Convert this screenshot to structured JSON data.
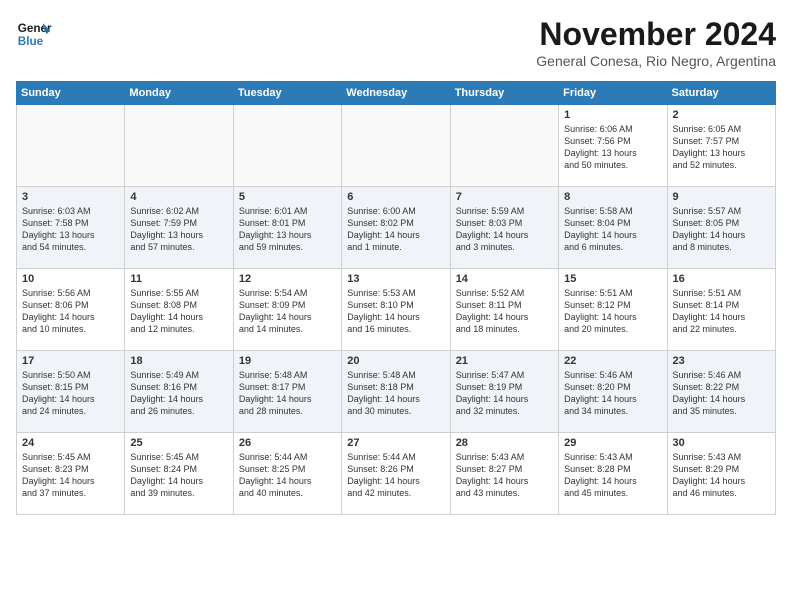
{
  "logo": {
    "line1": "General",
    "line2": "Blue"
  },
  "title": "November 2024",
  "subtitle": "General Conesa, Rio Negro, Argentina",
  "weekdays": [
    "Sunday",
    "Monday",
    "Tuesday",
    "Wednesday",
    "Thursday",
    "Friday",
    "Saturday"
  ],
  "weeks": [
    [
      {
        "day": "",
        "info": ""
      },
      {
        "day": "",
        "info": ""
      },
      {
        "day": "",
        "info": ""
      },
      {
        "day": "",
        "info": ""
      },
      {
        "day": "",
        "info": ""
      },
      {
        "day": "1",
        "info": "Sunrise: 6:06 AM\nSunset: 7:56 PM\nDaylight: 13 hours\nand 50 minutes."
      },
      {
        "day": "2",
        "info": "Sunrise: 6:05 AM\nSunset: 7:57 PM\nDaylight: 13 hours\nand 52 minutes."
      }
    ],
    [
      {
        "day": "3",
        "info": "Sunrise: 6:03 AM\nSunset: 7:58 PM\nDaylight: 13 hours\nand 54 minutes."
      },
      {
        "day": "4",
        "info": "Sunrise: 6:02 AM\nSunset: 7:59 PM\nDaylight: 13 hours\nand 57 minutes."
      },
      {
        "day": "5",
        "info": "Sunrise: 6:01 AM\nSunset: 8:01 PM\nDaylight: 13 hours\nand 59 minutes."
      },
      {
        "day": "6",
        "info": "Sunrise: 6:00 AM\nSunset: 8:02 PM\nDaylight: 14 hours\nand 1 minute."
      },
      {
        "day": "7",
        "info": "Sunrise: 5:59 AM\nSunset: 8:03 PM\nDaylight: 14 hours\nand 3 minutes."
      },
      {
        "day": "8",
        "info": "Sunrise: 5:58 AM\nSunset: 8:04 PM\nDaylight: 14 hours\nand 6 minutes."
      },
      {
        "day": "9",
        "info": "Sunrise: 5:57 AM\nSunset: 8:05 PM\nDaylight: 14 hours\nand 8 minutes."
      }
    ],
    [
      {
        "day": "10",
        "info": "Sunrise: 5:56 AM\nSunset: 8:06 PM\nDaylight: 14 hours\nand 10 minutes."
      },
      {
        "day": "11",
        "info": "Sunrise: 5:55 AM\nSunset: 8:08 PM\nDaylight: 14 hours\nand 12 minutes."
      },
      {
        "day": "12",
        "info": "Sunrise: 5:54 AM\nSunset: 8:09 PM\nDaylight: 14 hours\nand 14 minutes."
      },
      {
        "day": "13",
        "info": "Sunrise: 5:53 AM\nSunset: 8:10 PM\nDaylight: 14 hours\nand 16 minutes."
      },
      {
        "day": "14",
        "info": "Sunrise: 5:52 AM\nSunset: 8:11 PM\nDaylight: 14 hours\nand 18 minutes."
      },
      {
        "day": "15",
        "info": "Sunrise: 5:51 AM\nSunset: 8:12 PM\nDaylight: 14 hours\nand 20 minutes."
      },
      {
        "day": "16",
        "info": "Sunrise: 5:51 AM\nSunset: 8:14 PM\nDaylight: 14 hours\nand 22 minutes."
      }
    ],
    [
      {
        "day": "17",
        "info": "Sunrise: 5:50 AM\nSunset: 8:15 PM\nDaylight: 14 hours\nand 24 minutes."
      },
      {
        "day": "18",
        "info": "Sunrise: 5:49 AM\nSunset: 8:16 PM\nDaylight: 14 hours\nand 26 minutes."
      },
      {
        "day": "19",
        "info": "Sunrise: 5:48 AM\nSunset: 8:17 PM\nDaylight: 14 hours\nand 28 minutes."
      },
      {
        "day": "20",
        "info": "Sunrise: 5:48 AM\nSunset: 8:18 PM\nDaylight: 14 hours\nand 30 minutes."
      },
      {
        "day": "21",
        "info": "Sunrise: 5:47 AM\nSunset: 8:19 PM\nDaylight: 14 hours\nand 32 minutes."
      },
      {
        "day": "22",
        "info": "Sunrise: 5:46 AM\nSunset: 8:20 PM\nDaylight: 14 hours\nand 34 minutes."
      },
      {
        "day": "23",
        "info": "Sunrise: 5:46 AM\nSunset: 8:22 PM\nDaylight: 14 hours\nand 35 minutes."
      }
    ],
    [
      {
        "day": "24",
        "info": "Sunrise: 5:45 AM\nSunset: 8:23 PM\nDaylight: 14 hours\nand 37 minutes."
      },
      {
        "day": "25",
        "info": "Sunrise: 5:45 AM\nSunset: 8:24 PM\nDaylight: 14 hours\nand 39 minutes."
      },
      {
        "day": "26",
        "info": "Sunrise: 5:44 AM\nSunset: 8:25 PM\nDaylight: 14 hours\nand 40 minutes."
      },
      {
        "day": "27",
        "info": "Sunrise: 5:44 AM\nSunset: 8:26 PM\nDaylight: 14 hours\nand 42 minutes."
      },
      {
        "day": "28",
        "info": "Sunrise: 5:43 AM\nSunset: 8:27 PM\nDaylight: 14 hours\nand 43 minutes."
      },
      {
        "day": "29",
        "info": "Sunrise: 5:43 AM\nSunset: 8:28 PM\nDaylight: 14 hours\nand 45 minutes."
      },
      {
        "day": "30",
        "info": "Sunrise: 5:43 AM\nSunset: 8:29 PM\nDaylight: 14 hours\nand 46 minutes."
      }
    ]
  ]
}
